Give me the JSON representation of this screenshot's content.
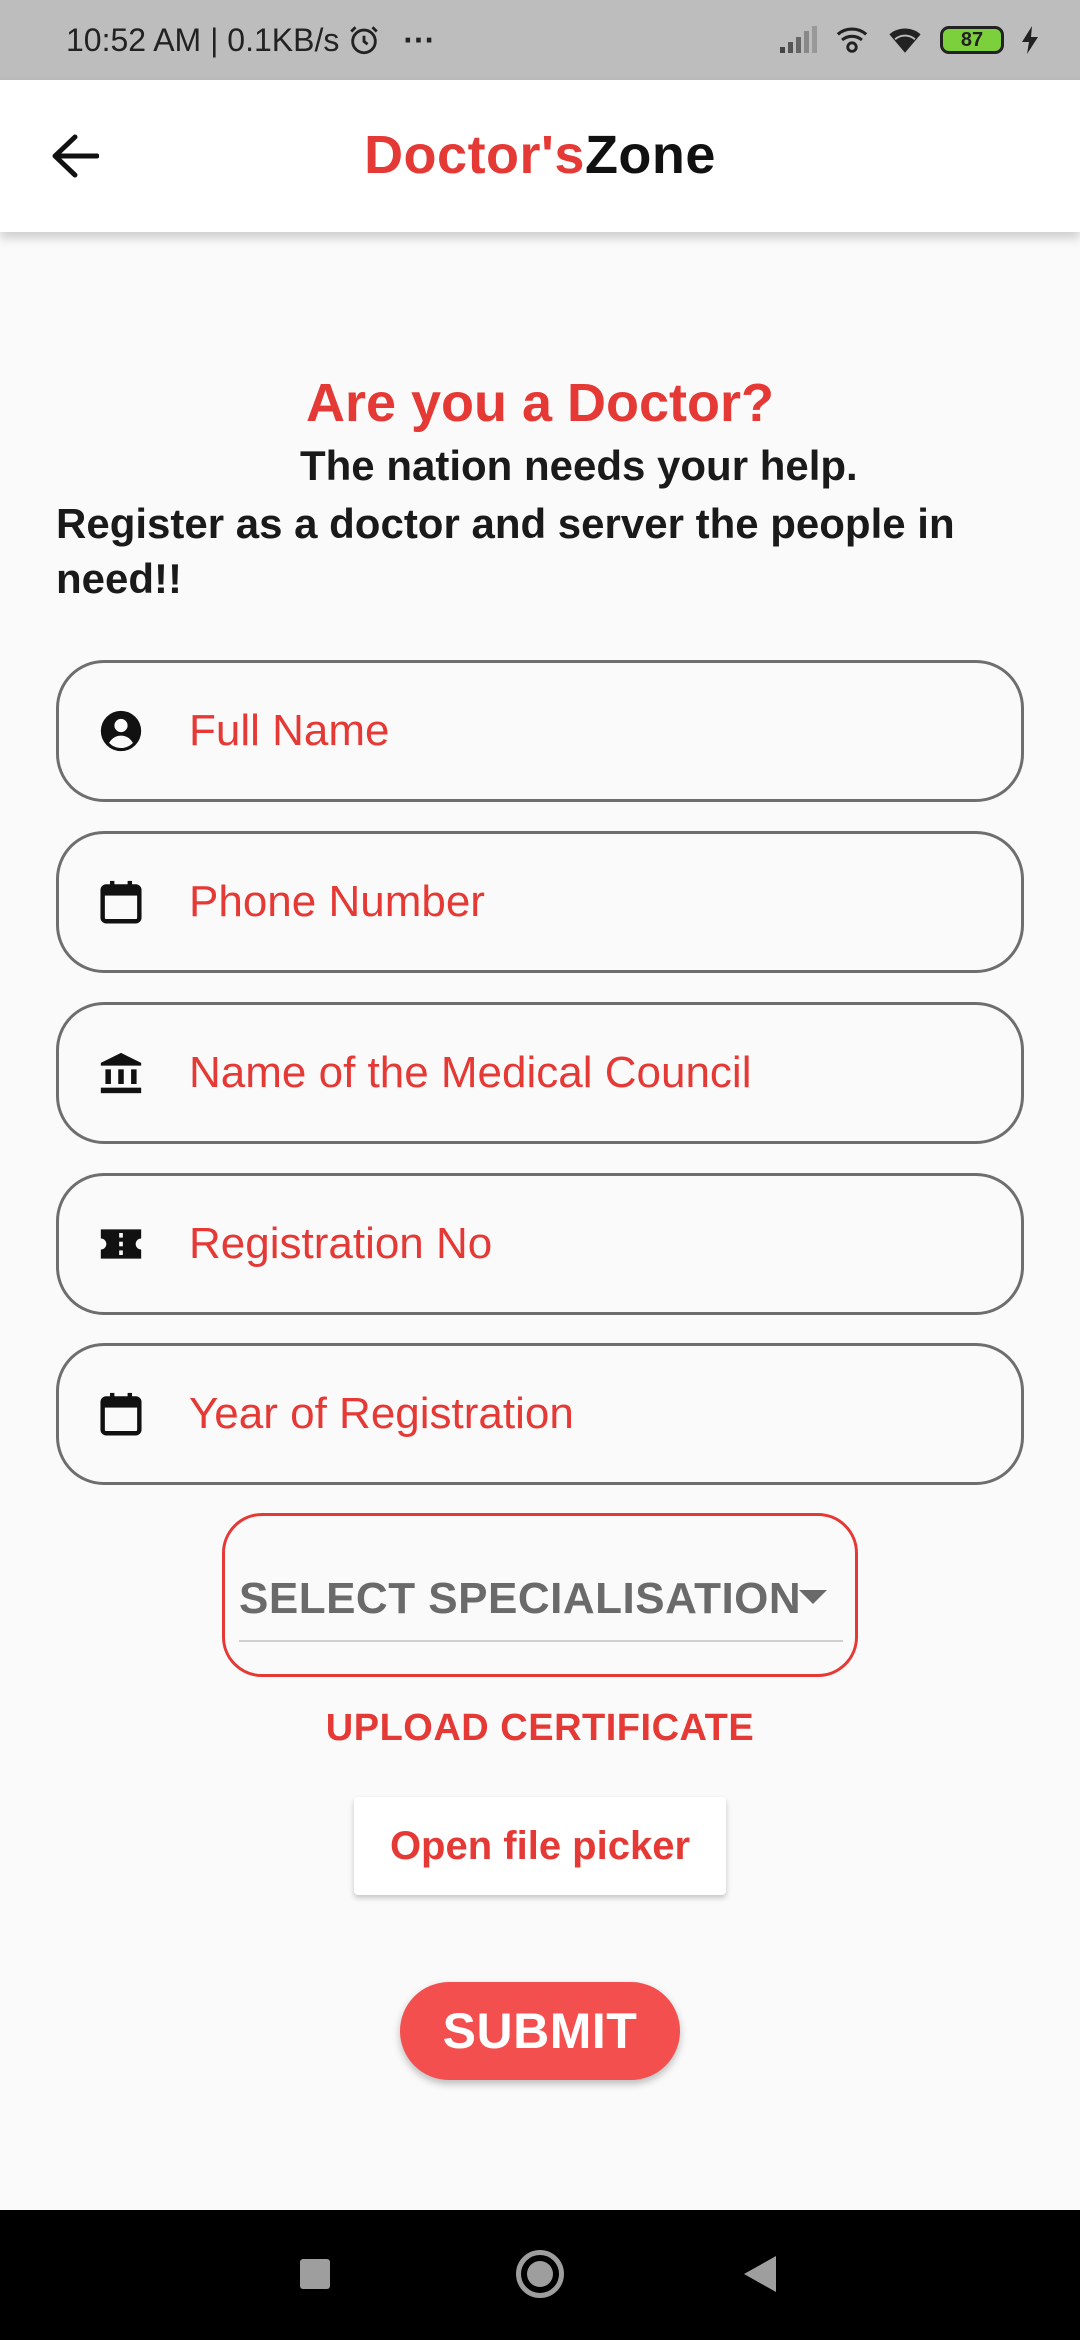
{
  "status_bar": {
    "time_speed": "10:52 AM | 0.1KB/s",
    "more": "···",
    "battery": "87"
  },
  "app_bar": {
    "title_part1": "Doctor's",
    "title_part2": "Zone",
    "back_icon": "arrow-back-icon"
  },
  "intro": {
    "heading": "Are you a Doctor?",
    "subheading": "The nation needs your help.",
    "description": "Register as a doctor and server the people in need!!"
  },
  "form": {
    "fields": [
      {
        "label": "Full Name",
        "icon": "account-circle-icon"
      },
      {
        "label": "Phone Number",
        "icon": "calendar-icon"
      },
      {
        "label": "Name of the Medical Council",
        "icon": "bank-icon"
      },
      {
        "label": "Registration No",
        "icon": "ticket-icon"
      },
      {
        "label": "Year of Registration",
        "icon": "calendar-icon"
      }
    ],
    "specialisation_select": "SELECT SPECIALISATION",
    "upload_label": "UPLOAD CERTIFICATE",
    "file_picker_button": "Open file picker",
    "submit_button": "SUBMIT"
  },
  "colors": {
    "accent": "#e53935",
    "submit": "#f44f4f",
    "background": "#fafafa",
    "status_bar": "#bdbdbd"
  }
}
